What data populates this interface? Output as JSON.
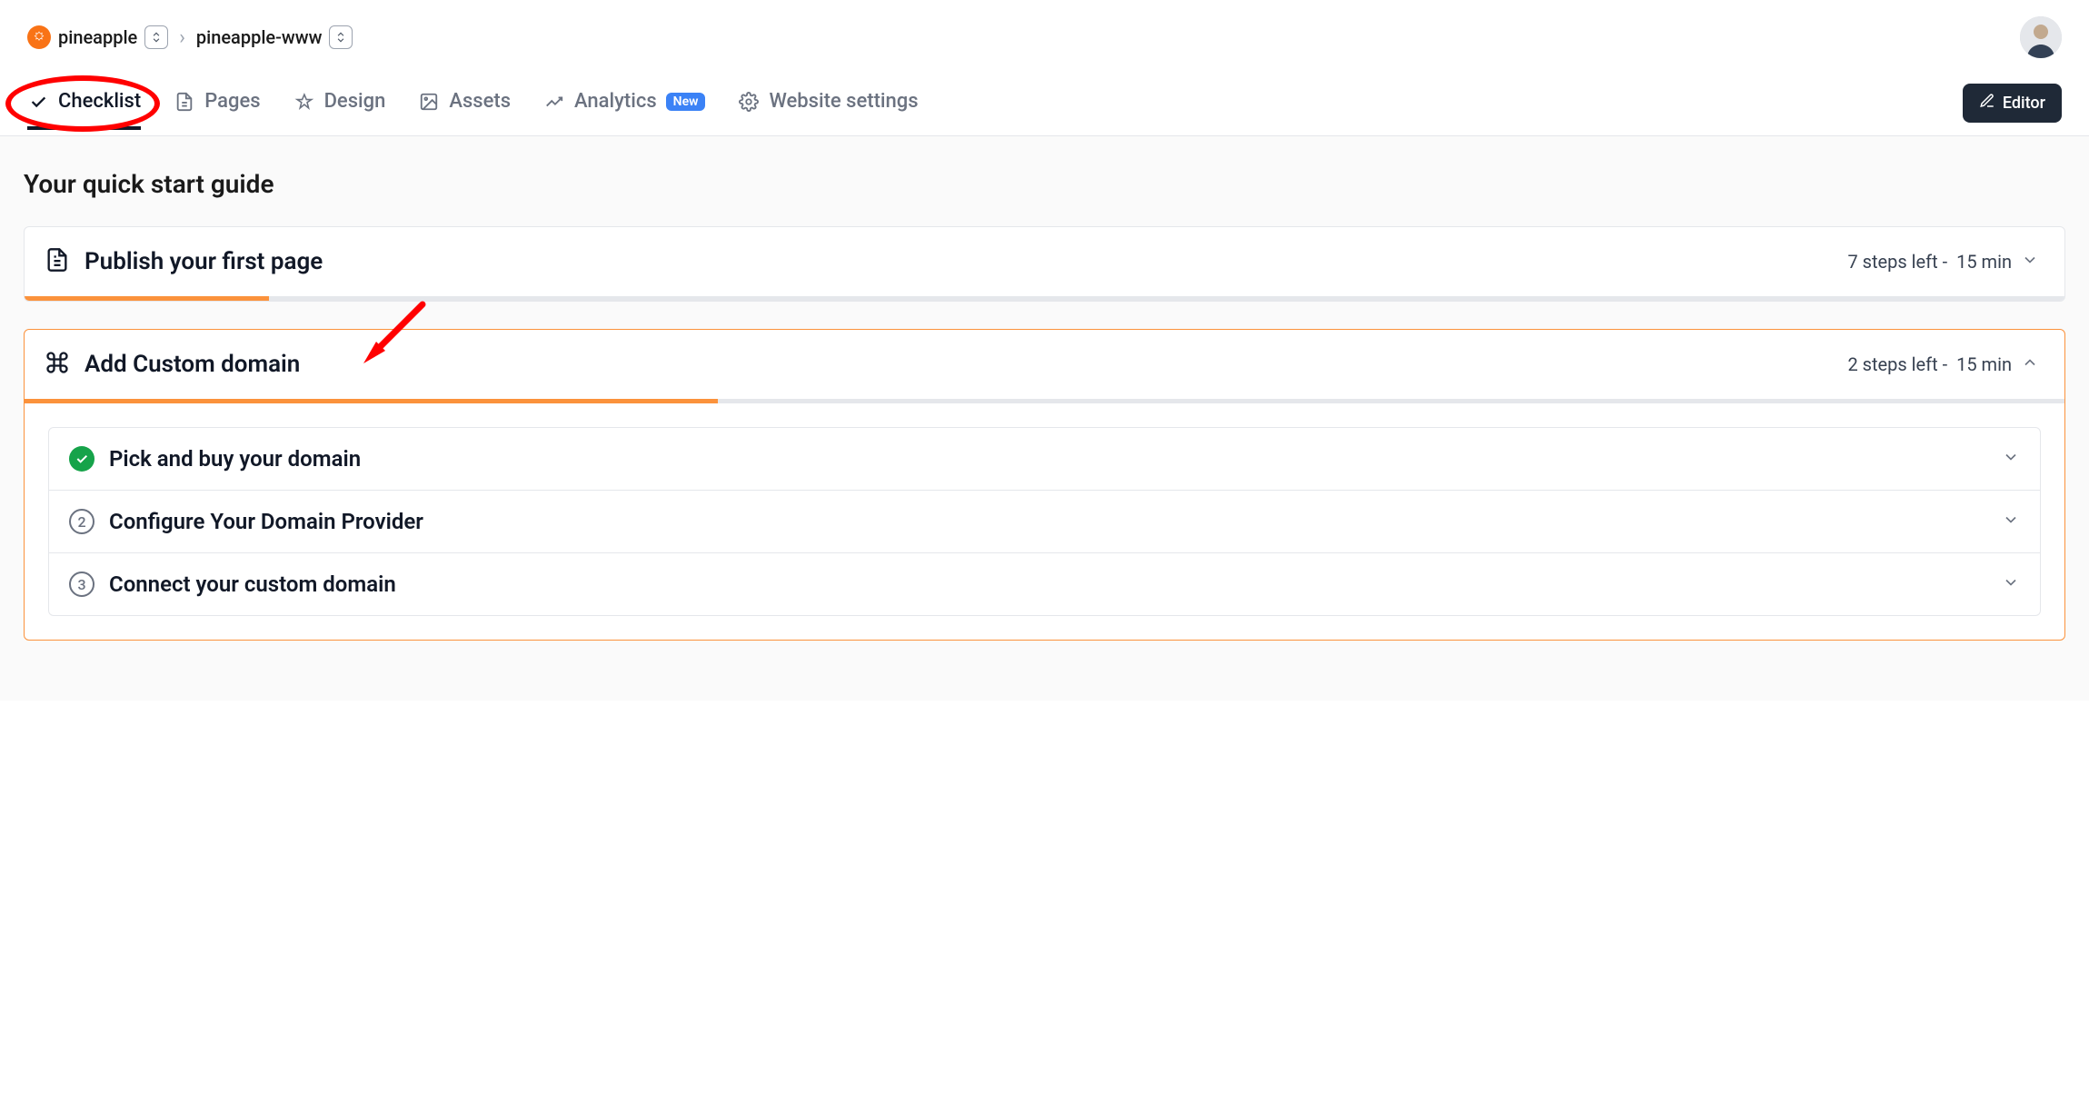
{
  "breadcrumb": {
    "org": "pineapple",
    "project": "pineapple-www"
  },
  "tabs": {
    "checklist": "Checklist",
    "pages": "Pages",
    "design": "Design",
    "assets": "Assets",
    "analytics": "Analytics",
    "analytics_badge": "New",
    "settings": "Website settings"
  },
  "editor_btn": "Editor",
  "page_title": "Your quick start guide",
  "cards": [
    {
      "title": "Publish your first page",
      "steps_left": "7 steps left -",
      "time": "15 min",
      "progress_pct": 12,
      "expanded": false
    },
    {
      "title": "Add Custom domain",
      "steps_left": "2 steps left -",
      "time": "15 min",
      "progress_pct": 34,
      "expanded": true,
      "steps": [
        {
          "done": true,
          "num": 1,
          "label": "Pick and buy your domain"
        },
        {
          "done": false,
          "num": 2,
          "label": "Configure Your Domain Provider"
        },
        {
          "done": false,
          "num": 3,
          "label": "Connect your custom domain"
        }
      ]
    }
  ]
}
